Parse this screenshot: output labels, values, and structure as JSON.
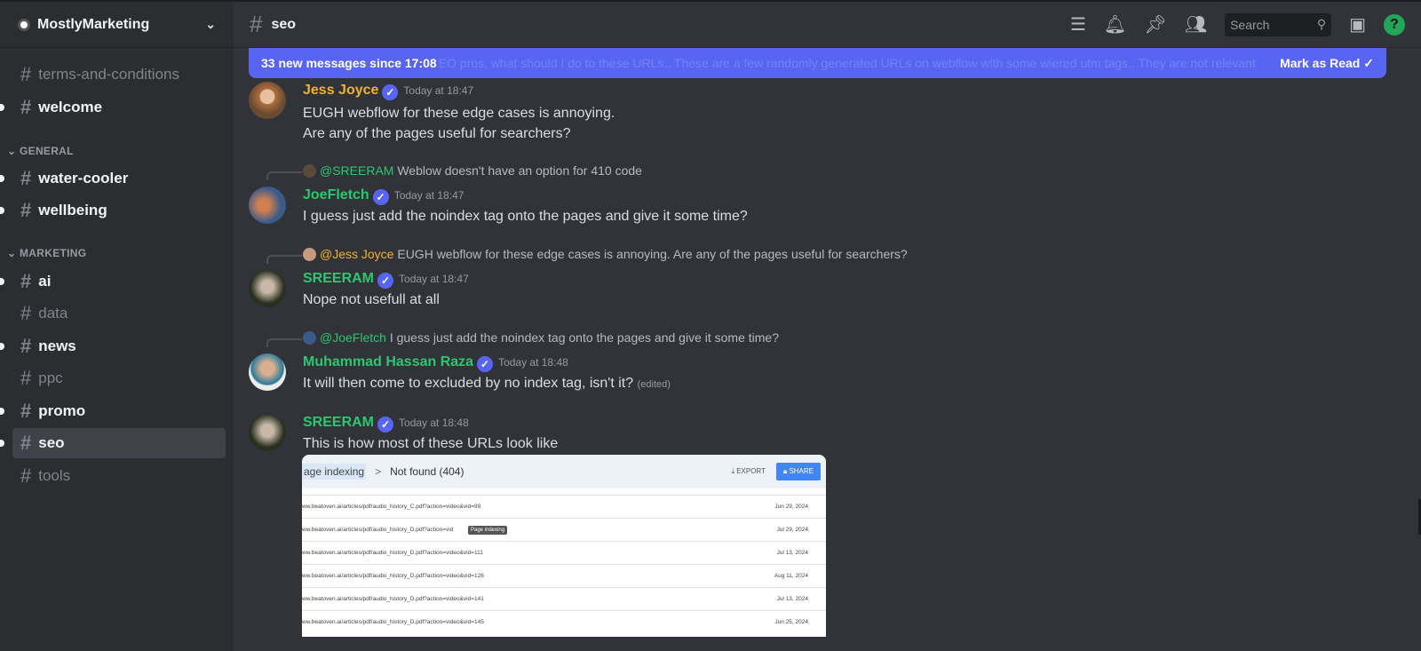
{
  "server": {
    "name": "MostlyMarketing"
  },
  "sidebar": {
    "channels_top": [
      {
        "name": "terms-and-conditions",
        "unread": false
      },
      {
        "name": "welcome",
        "unread": true
      }
    ],
    "categories": [
      {
        "label": "GENERAL",
        "channels": [
          {
            "name": "water-cooler",
            "unread": true
          },
          {
            "name": "wellbeing",
            "unread": true
          }
        ]
      },
      {
        "label": "MARKETING",
        "channels": [
          {
            "name": "ai",
            "unread": true
          },
          {
            "name": "data",
            "unread": false
          },
          {
            "name": "news",
            "unread": true
          },
          {
            "name": "ppc",
            "unread": false
          },
          {
            "name": "promo",
            "unread": true
          },
          {
            "name": "seo",
            "unread": true,
            "active": true
          },
          {
            "name": "tools",
            "unread": false
          }
        ]
      }
    ]
  },
  "header": {
    "channel": "seo",
    "search_placeholder": "Search"
  },
  "banner": {
    "text": "33 new messages since 17:08",
    "ghost": "EO pros, what should I do to these URLs.. These are a few randomly generated URLs on webflow with some wiered utm tags.. They are not relevant",
    "action": "Mark as Read"
  },
  "messages": [
    {
      "author": "Jess Joyce",
      "color": "#f0b232",
      "time": "Today at 18:47",
      "lines": [
        "EUGH webflow for these edge cases is annoying.",
        "Are any of the pages useful for searchers?"
      ]
    },
    {
      "reply_to": "@SREERAM",
      "reply_color": "#2dc770",
      "reply_text": "Weblow doesn't have an option for 410 code",
      "author": "JoeFletch",
      "color": "#2dc770",
      "time": "Today at 18:47",
      "lines": [
        "I guess just add the noindex tag onto the pages and give it some time?"
      ]
    },
    {
      "reply_to": "@Jess Joyce",
      "reply_color": "#f0b232",
      "reply_text": "EUGH webflow for these edge cases is annoying.  Are any of the pages useful for searchers?",
      "author": "SREERAM",
      "color": "#2dc770",
      "time": "Today at 18:47",
      "lines": [
        "Nope not usefull at all"
      ]
    },
    {
      "reply_to": "@JoeFletch",
      "reply_color": "#2dc770",
      "reply_text": "I guess just add the noindex tag onto the pages and give it some time?",
      "author": "Muhammad Hassan Raza",
      "color": "#2dc770",
      "time": "Today at 18:48",
      "lines": [
        "It will then come to excluded by no index tag, isn't it?"
      ],
      "edited": "(edited)"
    },
    {
      "author": "SREERAM",
      "color": "#2dc770",
      "time": "Today at 18:48",
      "lines": [
        "This is how most of these URLs look like"
      ]
    }
  ],
  "attachment": {
    "breadcrumb": "age indexing",
    "current": "Not found (404)",
    "export": "EXPORT",
    "share": "SHARE",
    "tooltip": "Page indexing",
    "rows": [
      {
        "url": "ww.beatoven.ai/articles/pdf/audio_history_C.pdf?action=video&vid=99",
        "date": "Jun 29, 2024"
      },
      {
        "url": "ww.beatoven.ai/articles/pdf/audio_history_D.pdf?action=vid",
        "date": "Jul 29, 2024"
      },
      {
        "url": "ww.beatoven.ai/articles/pdf/audio_history_D.pdf?action=video&vid=111",
        "date": "Jul 13, 2024"
      },
      {
        "url": "ww.beatoven.ai/articles/pdf/audio_history_D.pdf?action=video&vid=126",
        "date": "Aug 11, 2024"
      },
      {
        "url": "ww.beatoven.ai/articles/pdf/audio_history_D.pdf?action=video&vid=141",
        "date": "Jul 13, 2024"
      },
      {
        "url": "ww.beatoven.ai/articles/pdf/audio_history_D.pdf?action=video&vid=145",
        "date": "Jun 25, 2024"
      }
    ]
  }
}
